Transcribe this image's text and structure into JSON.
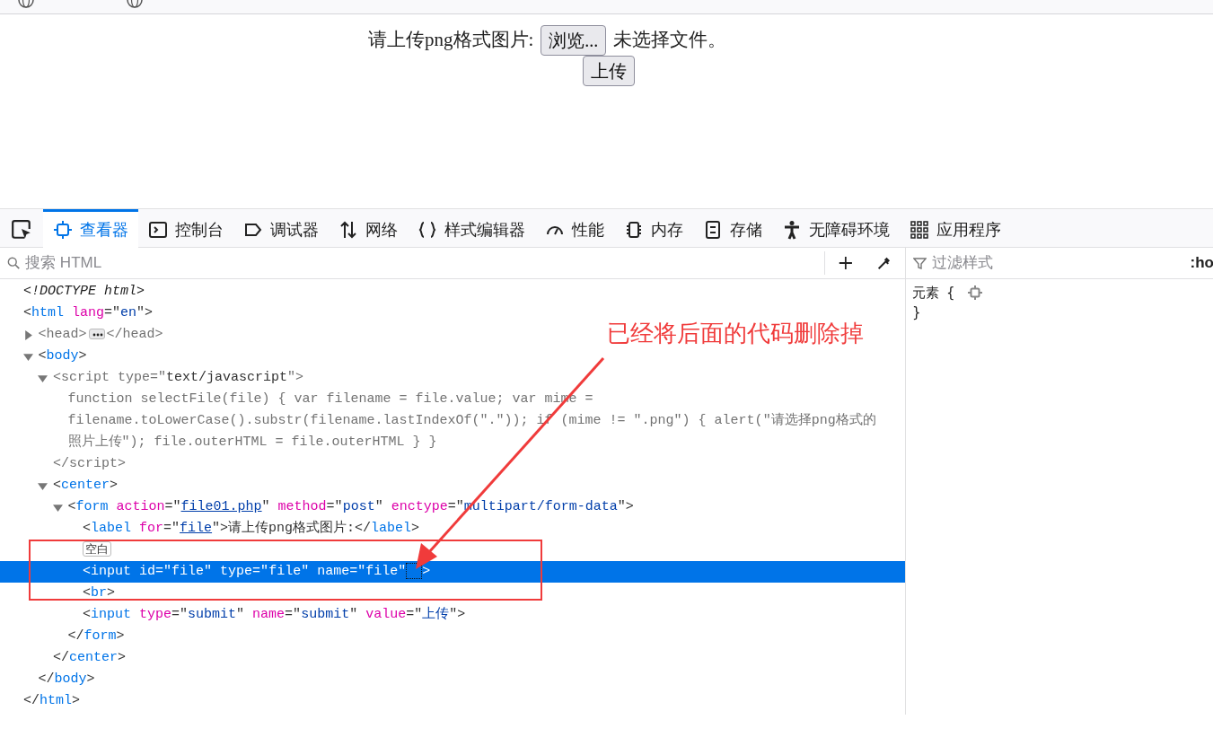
{
  "page": {
    "label": "请上传png格式图片:",
    "browse_button": "浏览...",
    "file_status": "未选择文件。",
    "submit_button": "上传"
  },
  "devtools": {
    "tabs": [
      {
        "label": "查看器",
        "kind": "inspector",
        "selected": true
      },
      {
        "label": "控制台",
        "kind": "console",
        "selected": false
      },
      {
        "label": "调试器",
        "kind": "debugger",
        "selected": false
      },
      {
        "label": "网络",
        "kind": "network",
        "selected": false
      },
      {
        "label": "样式编辑器",
        "kind": "style",
        "selected": false
      },
      {
        "label": "性能",
        "kind": "performance",
        "selected": false
      },
      {
        "label": "内存",
        "kind": "memory",
        "selected": false
      },
      {
        "label": "存储",
        "kind": "storage",
        "selected": false
      },
      {
        "label": "无障碍环境",
        "kind": "accessibility",
        "selected": false
      },
      {
        "label": "应用程序",
        "kind": "application",
        "selected": false
      }
    ],
    "search": {
      "placeholder": "搜索 HTML"
    },
    "filter": {
      "placeholder": "过滤样式"
    },
    "pseudo_toggle": ":ho",
    "rule": {
      "selector": "元素",
      "open_brace": "{",
      "close_brace": "}"
    },
    "tree": [
      {
        "selected": false,
        "parts": [
          {
            "kind": "doctype",
            "text": "<!DOCTYPE html>"
          }
        ]
      },
      {
        "selected": false,
        "parts": [
          {
            "kind": "punct",
            "text": "<"
          },
          {
            "kind": "tag",
            "text": "html"
          },
          {
            "kind": "attr",
            "text": " lang"
          },
          {
            "kind": "punct",
            "text": "=\""
          },
          {
            "kind": "value",
            "text": "en"
          },
          {
            "kind": "punct",
            "text": "\">"
          }
        ],
        "closing": [
          {
            "kind": "punct",
            "text": "</"
          },
          {
            "kind": "tag",
            "text": "html"
          },
          {
            "kind": "punct",
            "text": ">"
          }
        ],
        "children": [
          {
            "selected": false,
            "expanded": false,
            "parts": [
              {
                "kind": "muted",
                "text": "<head>"
              }
            ],
            "closing": [
              {
                "kind": "muted",
                "text": "</head>"
              }
            ]
          },
          {
            "selected": false,
            "expanded": true,
            "parts": [
              {
                "kind": "punct",
                "text": "<"
              },
              {
                "kind": "tag",
                "text": "body"
              },
              {
                "kind": "punct",
                "text": ">"
              }
            ],
            "closing": [
              {
                "kind": "punct",
                "text": "</"
              },
              {
                "kind": "tag",
                "text": "body"
              },
              {
                "kind": "punct",
                "text": ">"
              }
            ],
            "children": [
              {
                "selected": false,
                "expanded": true,
                "parts": [
                  {
                    "kind": "muted",
                    "text": "<script type=\""
                  },
                  {
                    "kind": "punct",
                    "text": "text/javascript"
                  },
                  {
                    "kind": "muted",
                    "text": "\">"
                  }
                ],
                "closing": [
                  {
                    "kind": "muted",
                    "text": "</script>"
                  }
                ],
                "children": [
                  {
                    "selected": false,
                    "text_lines": [
                      "function selectFile(file) { var filename = file.value; var mime =",
                      "filename.toLowerCase().substr(filename.lastIndexOf(\".\")); if (mime != \".png\") { alert(\"请选择png格式的",
                      "照片上传\"); file.outerHTML = file.outerHTML } }"
                    ]
                  }
                ]
              },
              {
                "selected": false,
                "expanded": true,
                "parts": [
                  {
                    "kind": "punct",
                    "text": "<"
                  },
                  {
                    "kind": "tag",
                    "text": "center"
                  },
                  {
                    "kind": "punct",
                    "text": ">"
                  }
                ],
                "closing": [
                  {
                    "kind": "punct",
                    "text": "</"
                  },
                  {
                    "kind": "tag",
                    "text": "center"
                  },
                  {
                    "kind": "punct",
                    "text": ">"
                  }
                ],
                "children": [
                  {
                    "selected": false,
                    "expanded": true,
                    "parts": [
                      {
                        "kind": "punct",
                        "text": "<"
                      },
                      {
                        "kind": "tag",
                        "text": "form"
                      },
                      {
                        "kind": "attr",
                        "text": " action"
                      },
                      {
                        "kind": "punct",
                        "text": "=\""
                      },
                      {
                        "kind": "link",
                        "text": "file01.php"
                      },
                      {
                        "kind": "punct",
                        "text": "\""
                      },
                      {
                        "kind": "attr",
                        "text": " method"
                      },
                      {
                        "kind": "punct",
                        "text": "=\""
                      },
                      {
                        "kind": "value",
                        "text": "post"
                      },
                      {
                        "kind": "punct",
                        "text": "\""
                      },
                      {
                        "kind": "attr",
                        "text": " enctype"
                      },
                      {
                        "kind": "punct",
                        "text": "=\""
                      },
                      {
                        "kind": "value",
                        "text": "multipart/form-data"
                      },
                      {
                        "kind": "punct",
                        "text": "\">"
                      }
                    ],
                    "closing": [
                      {
                        "kind": "punct",
                        "text": "</"
                      },
                      {
                        "kind": "tag",
                        "text": "form"
                      },
                      {
                        "kind": "punct",
                        "text": ">"
                      }
                    ],
                    "children": [
                      {
                        "selected": false,
                        "parts": [
                          {
                            "kind": "punct",
                            "text": "<"
                          },
                          {
                            "kind": "tag",
                            "text": "label"
                          },
                          {
                            "kind": "attr",
                            "text": " for"
                          },
                          {
                            "kind": "punct",
                            "text": "=\""
                          },
                          {
                            "kind": "link",
                            "text": "file"
                          },
                          {
                            "kind": "punct",
                            "text": "\">请上传png格式图片:</"
                          },
                          {
                            "kind": "tag",
                            "text": "label"
                          },
                          {
                            "kind": "punct",
                            "text": ">"
                          }
                        ]
                      },
                      {
                        "selected": false,
                        "badge": "空白"
                      },
                      {
                        "selected": true,
                        "focus": true,
                        "parts": [
                          {
                            "kind": "punct",
                            "text": "<"
                          },
                          {
                            "kind": "tag",
                            "text": "input"
                          },
                          {
                            "kind": "attr",
                            "text": " id"
                          },
                          {
                            "kind": "punct",
                            "text": "=\""
                          },
                          {
                            "kind": "value",
                            "text": "file"
                          },
                          {
                            "kind": "punct",
                            "text": "\""
                          },
                          {
                            "kind": "attr",
                            "text": " type"
                          },
                          {
                            "kind": "punct",
                            "text": "=\""
                          },
                          {
                            "kind": "value",
                            "text": "file"
                          },
                          {
                            "kind": "punct",
                            "text": "\""
                          },
                          {
                            "kind": "attr",
                            "text": " name"
                          },
                          {
                            "kind": "punct",
                            "text": "=\""
                          },
                          {
                            "kind": "value",
                            "text": "file"
                          },
                          {
                            "kind": "punct",
                            "text": "\""
                          }
                        ],
                        "after": ">"
                      },
                      {
                        "selected": false,
                        "parts": [
                          {
                            "kind": "punct",
                            "text": "<"
                          },
                          {
                            "kind": "tag",
                            "text": "br"
                          },
                          {
                            "kind": "punct",
                            "text": ">"
                          }
                        ]
                      },
                      {
                        "selected": false,
                        "parts": [
                          {
                            "kind": "punct",
                            "text": "<"
                          },
                          {
                            "kind": "tag",
                            "text": "input"
                          },
                          {
                            "kind": "attr",
                            "text": " type"
                          },
                          {
                            "kind": "punct",
                            "text": "=\""
                          },
                          {
                            "kind": "value",
                            "text": "submit"
                          },
                          {
                            "kind": "punct",
                            "text": "\""
                          },
                          {
                            "kind": "attr",
                            "text": " name"
                          },
                          {
                            "kind": "punct",
                            "text": "=\""
                          },
                          {
                            "kind": "value",
                            "text": "submit"
                          },
                          {
                            "kind": "punct",
                            "text": "\""
                          },
                          {
                            "kind": "attr",
                            "text": " value"
                          },
                          {
                            "kind": "punct",
                            "text": "=\""
                          },
                          {
                            "kind": "value",
                            "text": "上传"
                          },
                          {
                            "kind": "punct",
                            "text": "\">"
                          }
                        ]
                      }
                    ]
                  }
                ]
              }
            ]
          }
        ]
      }
    ]
  },
  "annotation": {
    "text": "已经将后面的代码删除掉"
  }
}
